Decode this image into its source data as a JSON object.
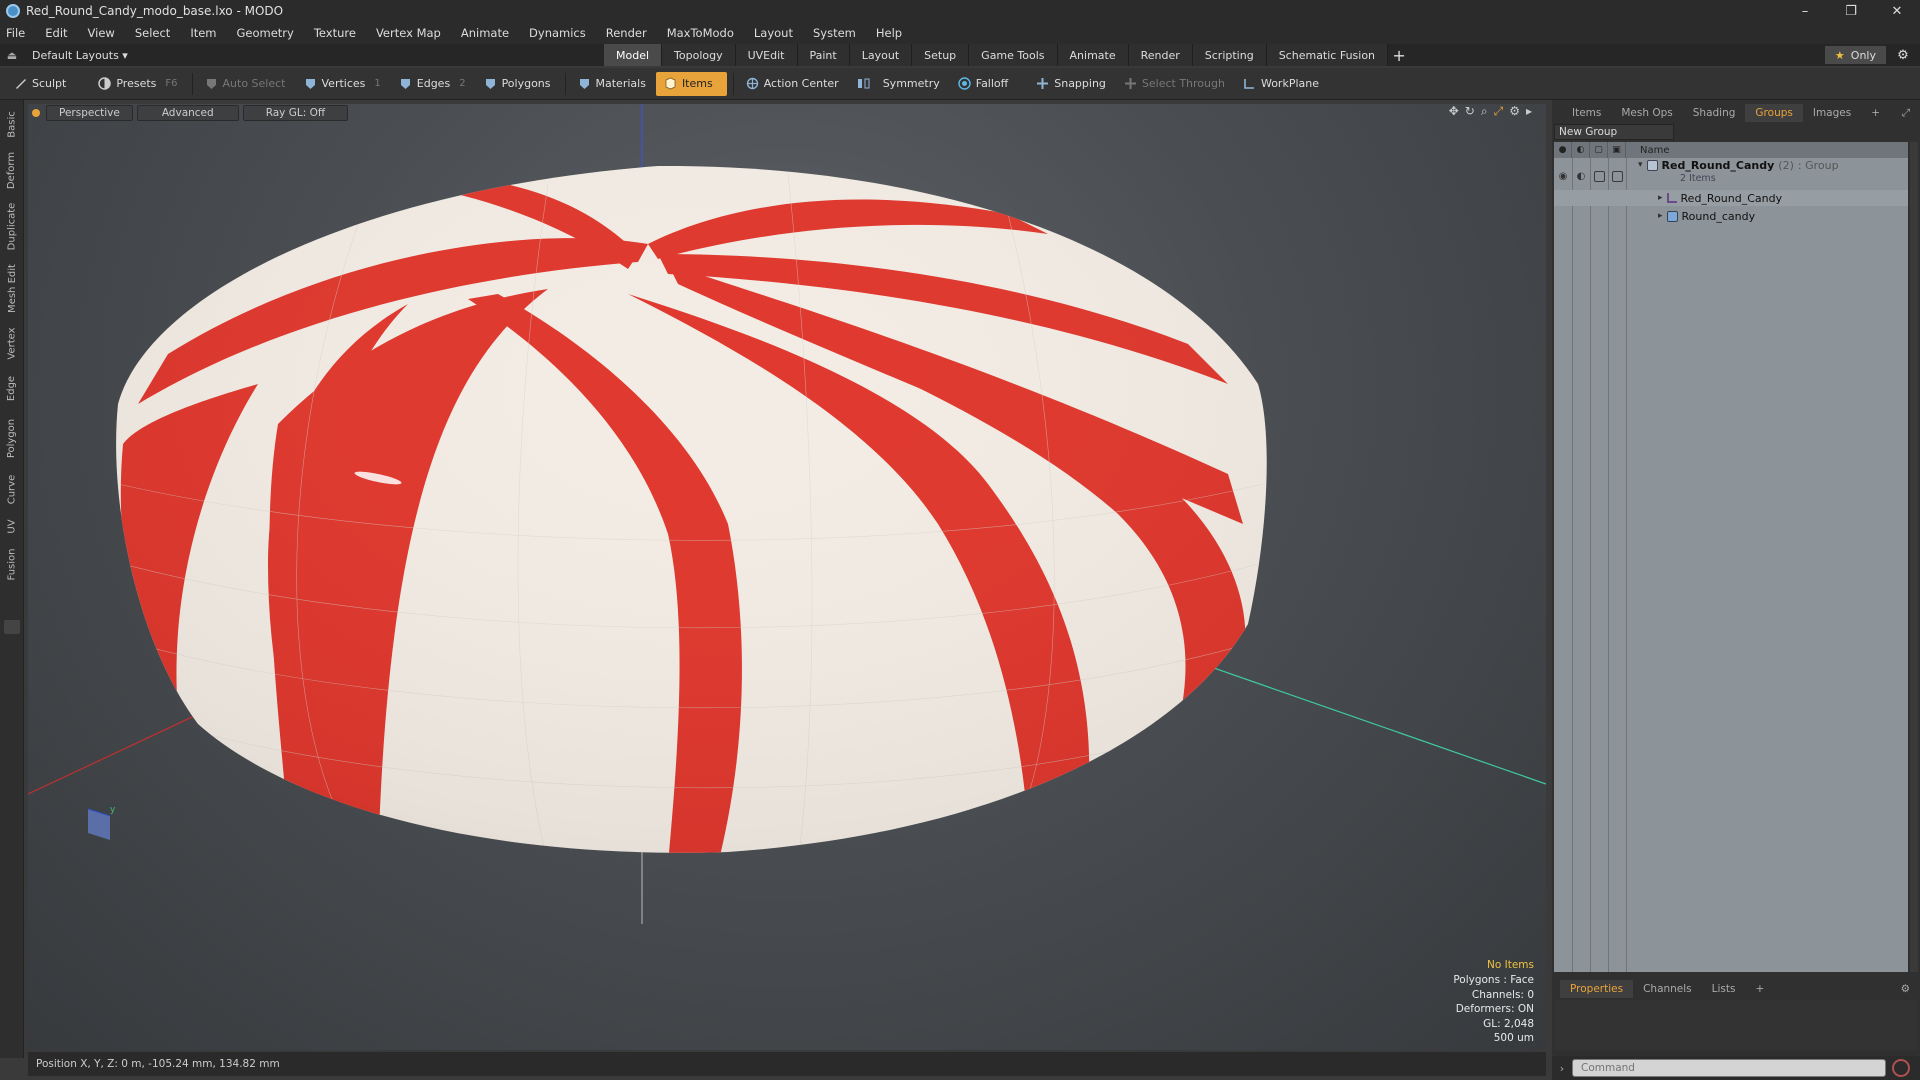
{
  "window": {
    "title": "Red_Round_Candy_modo_base.lxo - MODO",
    "controls": [
      "–",
      "❐",
      "✕"
    ]
  },
  "menu": [
    "File",
    "Edit",
    "View",
    "Select",
    "Item",
    "Geometry",
    "Texture",
    "Vertex Map",
    "Animate",
    "Dynamics",
    "Render",
    "MaxToModo",
    "Layout",
    "System",
    "Help"
  ],
  "layoutbar": {
    "layout_dropdown": "Default Layouts ▾",
    "tabs": [
      "Model",
      "Topology",
      "UVEdit",
      "Paint",
      "Layout",
      "Setup",
      "Game Tools",
      "Animate",
      "Render",
      "Scripting",
      "Schematic Fusion"
    ],
    "active_tab": "Model",
    "only_label": "Only",
    "only_star": "★"
  },
  "toolbar": {
    "sculpt": "Sculpt",
    "presets": "Presets",
    "presets_hint": "F6",
    "auto_select": "Auto Select",
    "vertices": "Vertices",
    "vertices_hint": "1",
    "edges": "Edges",
    "edges_hint": "2",
    "polygons": "Polygons",
    "materials": "Materials",
    "items": "Items",
    "action_center": "Action Center",
    "symmetry": "Symmetry",
    "falloff": "Falloff",
    "snapping": "Snapping",
    "select_through": "Select Through",
    "workplane": "WorkPlane"
  },
  "left_tabs": [
    "Basic",
    "Deform",
    "Duplicate",
    "Mesh Edit",
    "Vertex",
    "Edge",
    "Polygon",
    "Curve",
    "UV",
    "Fusion"
  ],
  "viewport": {
    "view_mode": "Perspective",
    "shading": "Advanced",
    "raygl": "Ray GL: Off",
    "info": {
      "no_items": "No Items",
      "polygons": "Polygons : Face",
      "channels": "Channels: 0",
      "deformers": "Deformers: ON",
      "gl": "GL: 2,048",
      "units": "500 um"
    },
    "colors": {
      "candy_red": "#e0382e",
      "candy_white": "#f3ece4"
    }
  },
  "status": {
    "position": "Position X, Y, Z:  0 m, -105.24 mm, 134.82 mm"
  },
  "right_panel": {
    "tabs": [
      "Items",
      "Mesh Ops",
      "Shading",
      "Groups",
      "Images"
    ],
    "active_tab": "Groups",
    "new_group": "New Group",
    "column_name": "Name",
    "group": {
      "name": "Red_Round_Candy",
      "count": "(2)",
      "type": ": Group",
      "sub": "2 Items"
    },
    "children": [
      "Red_Round_Candy",
      "Round_candy"
    ],
    "bottom_tabs": [
      "Properties",
      "Channels",
      "Lists"
    ],
    "bottom_active": "Properties",
    "command_placeholder": "Command"
  }
}
